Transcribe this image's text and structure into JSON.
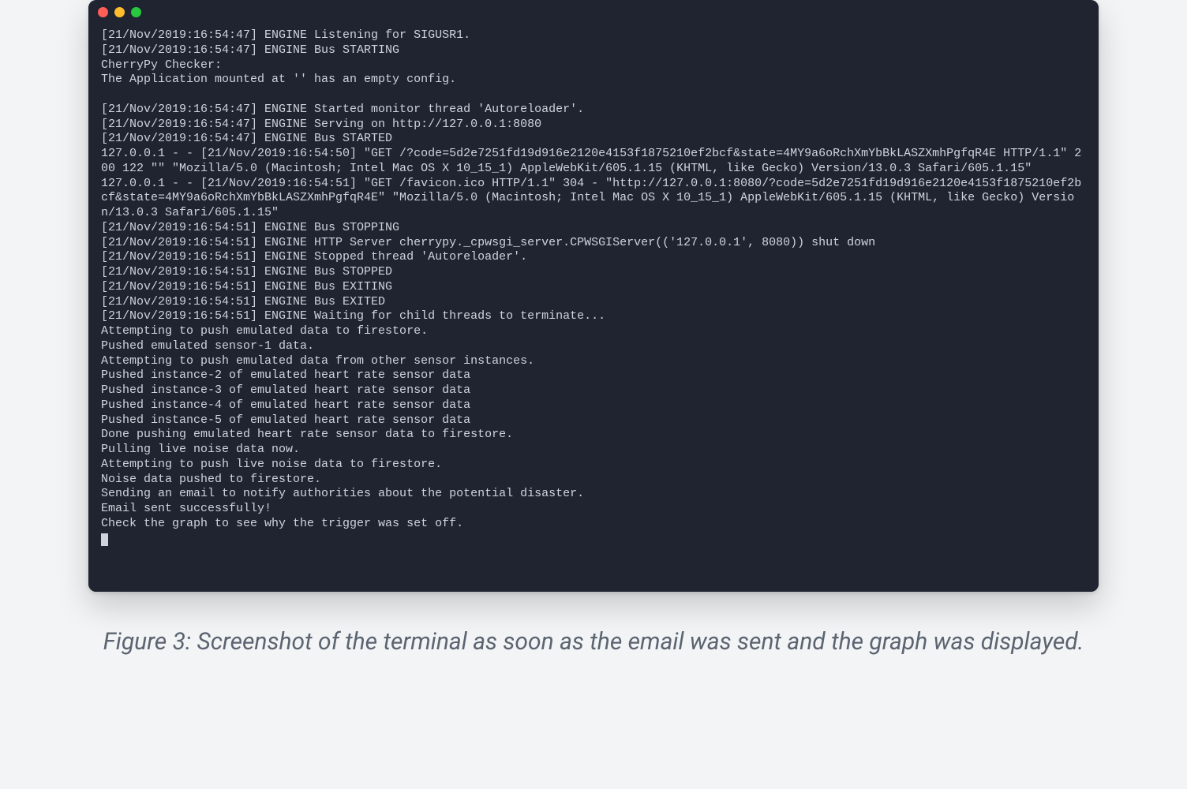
{
  "window": {
    "traffic_lights": [
      "close",
      "minimize",
      "zoom"
    ]
  },
  "terminal": {
    "lines": [
      "[21/Nov/2019:16:54:47] ENGINE Listening for SIGUSR1.",
      "[21/Nov/2019:16:54:47] ENGINE Bus STARTING",
      "CherryPy Checker:",
      "The Application mounted at '' has an empty config.",
      "",
      "[21/Nov/2019:16:54:47] ENGINE Started monitor thread 'Autoreloader'.",
      "[21/Nov/2019:16:54:47] ENGINE Serving on http://127.0.0.1:8080",
      "[21/Nov/2019:16:54:47] ENGINE Bus STARTED",
      "127.0.0.1 - - [21/Nov/2019:16:54:50] \"GET /?code=5d2e7251fd19d916e2120e4153f1875210ef2bcf&state=4MY9a6oRchXmYbBkLASZXmhPgfqR4E HTTP/1.1\" 200 122 \"\" \"Mozilla/5.0 (Macintosh; Intel Mac OS X 10_15_1) AppleWebKit/605.1.15 (KHTML, like Gecko) Version/13.0.3 Safari/605.1.15\"",
      "127.0.0.1 - - [21/Nov/2019:16:54:51] \"GET /favicon.ico HTTP/1.1\" 304 - \"http://127.0.0.1:8080/?code=5d2e7251fd19d916e2120e4153f1875210ef2bcf&state=4MY9a6oRchXmYbBkLASZXmhPgfqR4E\" \"Mozilla/5.0 (Macintosh; Intel Mac OS X 10_15_1) AppleWebKit/605.1.15 (KHTML, like Gecko) Version/13.0.3 Safari/605.1.15\"",
      "[21/Nov/2019:16:54:51] ENGINE Bus STOPPING",
      "[21/Nov/2019:16:54:51] ENGINE HTTP Server cherrypy._cpwsgi_server.CPWSGIServer(('127.0.0.1', 8080)) shut down",
      "[21/Nov/2019:16:54:51] ENGINE Stopped thread 'Autoreloader'.",
      "[21/Nov/2019:16:54:51] ENGINE Bus STOPPED",
      "[21/Nov/2019:16:54:51] ENGINE Bus EXITING",
      "[21/Nov/2019:16:54:51] ENGINE Bus EXITED",
      "[21/Nov/2019:16:54:51] ENGINE Waiting for child threads to terminate...",
      "Attempting to push emulated data to firestore.",
      "Pushed emulated sensor-1 data.",
      "Attempting to push emulated data from other sensor instances.",
      "Pushed instance-2 of emulated heart rate sensor data",
      "Pushed instance-3 of emulated heart rate sensor data",
      "Pushed instance-4 of emulated heart rate sensor data",
      "Pushed instance-5 of emulated heart rate sensor data",
      "Done pushing emulated heart rate sensor data to firestore.",
      "Pulling live noise data now.",
      "Attempting to push live noise data to firestore.",
      "Noise data pushed to firestore.",
      "Sending an email to notify authorities about the potential disaster.",
      "Email sent successfully!",
      "Check the graph to see why the trigger was set off."
    ]
  },
  "caption": {
    "text": "Figure 3: Screenshot of the terminal as soon as the email was sent and the graph was displayed."
  }
}
